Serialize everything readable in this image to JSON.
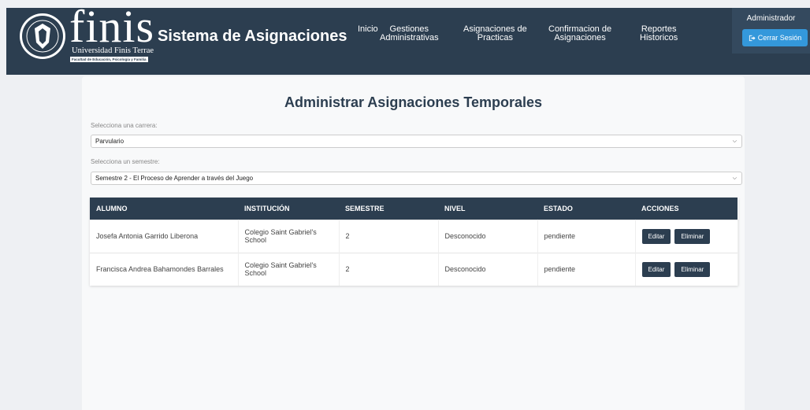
{
  "header": {
    "logo_text": "finis",
    "logo_subtitle": "Universidad Finis Terrae",
    "logo_tagline": "Facultad de Educación, Psicología y Familia",
    "app_title": "Sistema de Asignaciones",
    "nav": [
      {
        "line1": "Inicio",
        "line2": ""
      },
      {
        "line1": "Gestiones",
        "line2": "Administrativas"
      },
      {
        "line1": "Asignaciones de",
        "line2": "Practicas"
      },
      {
        "line1": "Confirmacion de",
        "line2": "Asignaciones"
      },
      {
        "line1": "Reportes",
        "line2": "Historicos"
      }
    ],
    "user": "Administrador",
    "logout_label": "Cerrar Sesión"
  },
  "page": {
    "title": "Administrar Asignaciones Temporales",
    "career_label": "Selecciona una carrera:",
    "career_value": "Parvulario",
    "semester_label": "Selecciona un semestre:",
    "semester_value": "Semestre 2 - El Proceso de Aprender a través del Juego"
  },
  "table": {
    "headers": [
      "ALUMNO",
      "INSTITUCIÓN",
      "SEMESTRE",
      "NIVEL",
      "ESTADO",
      "ACCIONES"
    ],
    "rows": [
      {
        "alumno": "Josefa Antonia Garrido Liberona",
        "institucion": "Colegio Saint Gabriel's School",
        "semestre": "2",
        "nivel": "Desconocido",
        "estado": "pendiente"
      },
      {
        "alumno": "Francisca Andrea Bahamondes Barrales",
        "institucion": "Colegio Saint Gabriel's School",
        "semestre": "2",
        "nivel": "Desconocido",
        "estado": "pendiente"
      }
    ],
    "edit_label": "Editar",
    "delete_label": "Eliminar"
  },
  "colors": {
    "header_bg": "#2c3e50",
    "accent_blue": "#3498db",
    "button_bg": "#2c3e50"
  }
}
